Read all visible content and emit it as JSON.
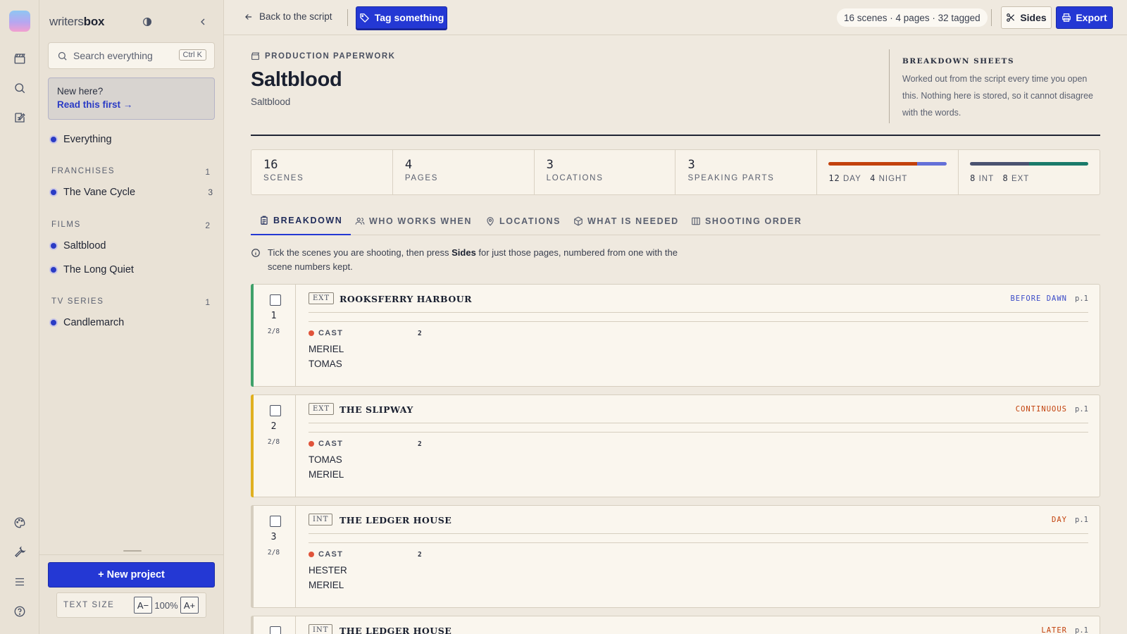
{
  "brand": {
    "prefix": "writers",
    "suffix": "box"
  },
  "search": {
    "placeholder": "Search everything",
    "shortcut": "Ctrl K"
  },
  "newhere": {
    "line1": "New here?",
    "link": "Read this first →"
  },
  "nav": {
    "everything": "Everything",
    "franchises": {
      "label": "FRANCHISES",
      "count": "1",
      "items": [
        {
          "label": "The Vane Cycle",
          "count": "3"
        }
      ]
    },
    "films": {
      "label": "FILMS",
      "count": "2",
      "items": [
        {
          "label": "Saltblood"
        },
        {
          "label": "The Long Quiet"
        }
      ]
    },
    "tv": {
      "label": "TV SERIES",
      "count": "1",
      "items": [
        {
          "label": "Candlemarch"
        }
      ]
    }
  },
  "footer": {
    "new_project": "+ New project",
    "text_size_label": "TEXT SIZE",
    "decrease": "A−",
    "zoom": "100%",
    "increase": "A+"
  },
  "topbar": {
    "back": "Back to the script",
    "tag": "Tag something",
    "stats": "16 scenes · 4 pages · 32 tagged",
    "sides": "Sides",
    "export": "Export"
  },
  "page": {
    "eyebrow": "PRODUCTION PAPERWORK",
    "title": "Saltblood",
    "subtitle": "Saltblood",
    "aside_title": "BREAKDOWN SHEETS",
    "aside_text": "Worked out from the script every time you open this. Nothing here is stored, so it cannot disagree with the words."
  },
  "stats": [
    {
      "num": "16",
      "label": "SCENES"
    },
    {
      "num": "4",
      "label": "PAGES"
    },
    {
      "num": "3",
      "label": "LOCATIONS"
    },
    {
      "num": "3",
      "label": "SPEAKING PARTS"
    }
  ],
  "daynight": {
    "day": "12",
    "day_label": "DAY",
    "night": "4",
    "night_label": "NIGHT",
    "day_color": "#c2410c",
    "night_color": "#6470d8"
  },
  "intext": {
    "int": "8",
    "int_label": "INT",
    "ext": "8",
    "ext_label": "EXT",
    "int_color": "#4a5270",
    "ext_color": "#1a7a6a"
  },
  "tabs": [
    "BREAKDOWN",
    "WHO WORKS WHEN",
    "LOCATIONS",
    "WHAT IS NEEDED",
    "SHOOTING ORDER"
  ],
  "hint": {
    "pre": "Tick the scenes you are shooting, then press ",
    "bold": "Sides",
    "post": " for just those pages, numbered from one with the scene numbers kept."
  },
  "scenes": [
    {
      "num": "1",
      "eighths": "2/8",
      "ie": "EXT",
      "location": "ROOKSFERRY HARBOUR",
      "tod": "BEFORE DAWN",
      "tod_color": "#3b4bc8",
      "page": "p.1",
      "stripe": "#3fa16a",
      "cast_label": "CAST",
      "cast_count": "2",
      "cast": [
        "MERIEL",
        "TOMAS"
      ]
    },
    {
      "num": "2",
      "eighths": "2/8",
      "ie": "EXT",
      "location": "THE SLIPWAY",
      "tod": "CONTINUOUS",
      "tod_color": "#c2410c",
      "page": "p.1",
      "stripe": "#e0b020",
      "cast_label": "CAST",
      "cast_count": "2",
      "cast": [
        "TOMAS",
        "MERIEL"
      ]
    },
    {
      "num": "3",
      "eighths": "2/8",
      "ie": "INT",
      "location": "THE LEDGER HOUSE",
      "tod": "DAY",
      "tod_color": "#c2410c",
      "page": "p.1",
      "stripe": "#d6cebf",
      "cast_label": "CAST",
      "cast_count": "2",
      "cast": [
        "HESTER",
        "MERIEL"
      ]
    },
    {
      "num": "",
      "eighths": "",
      "ie": "INT",
      "location": "THE LEDGER HOUSE",
      "tod": "LATER",
      "tod_color": "#c2410c",
      "page": "p.1",
      "stripe": "#d6cebf",
      "cast_label": "",
      "cast_count": "",
      "cast": []
    }
  ]
}
